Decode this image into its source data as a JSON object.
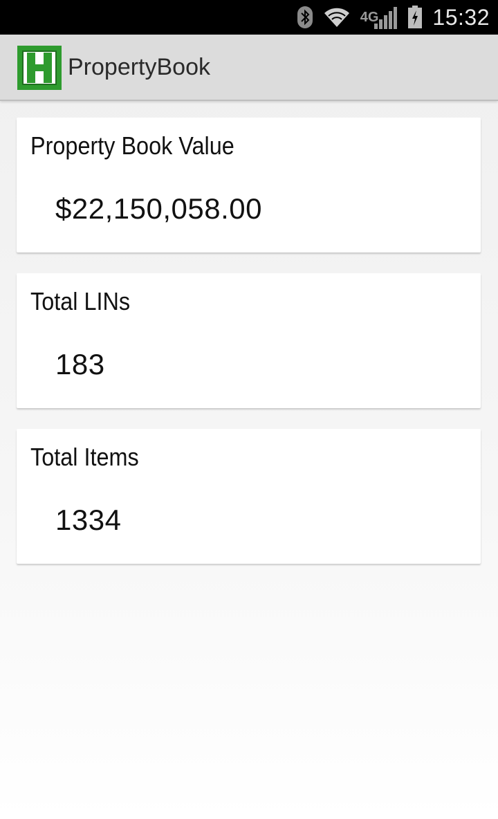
{
  "status_bar": {
    "time": "15:32",
    "network_label": "4G",
    "icons": [
      "bluetooth-icon",
      "wifi-icon",
      "signal-icon",
      "battery-charging-icon"
    ]
  },
  "app_bar": {
    "title": "PropertyBook",
    "logo_icon": "app-logo-h-icon"
  },
  "cards": [
    {
      "label": "Property Book Value",
      "value": "$22,150,058.00"
    },
    {
      "label": "Total LINs",
      "value": "183"
    },
    {
      "label": "Total Items",
      "value": "1334"
    }
  ],
  "colors": {
    "logo_green": "#2e9b2e",
    "action_bar": "#dcdcdc",
    "status_bar": "#000000"
  }
}
